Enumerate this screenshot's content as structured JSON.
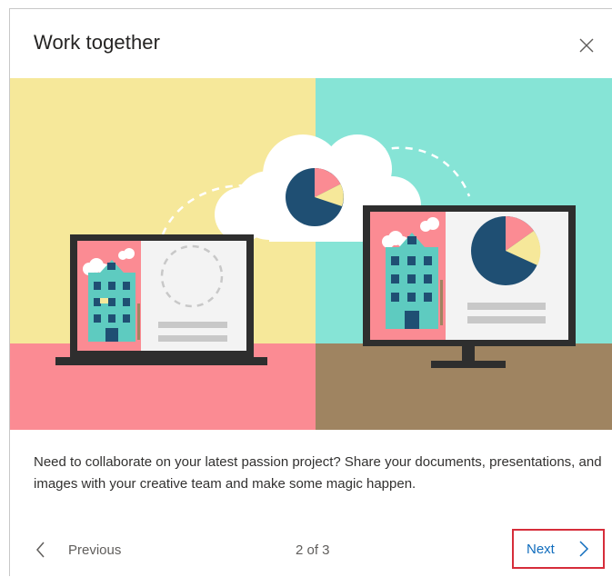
{
  "dialog": {
    "title": "Work together",
    "description": "Need to collaborate on your latest passion project? Share your documents, presentations, and images with your creative team and make some magic happen.",
    "close_icon": "close-icon"
  },
  "footer": {
    "previous_label": "Previous",
    "page_indicator": "2 of 3",
    "next_label": "Next",
    "prev_icon": "chevron-left-icon",
    "next_icon": "chevron-right-icon"
  },
  "colors": {
    "accent_link": "#0f6cbd",
    "highlight_border": "#d62d3a",
    "panel_yellow": "#f6e89a",
    "panel_teal": "#86e4d6",
    "floor_pink": "#fb8b93",
    "floor_brown": "#9f8461",
    "pie_navy": "#1f4f73"
  }
}
